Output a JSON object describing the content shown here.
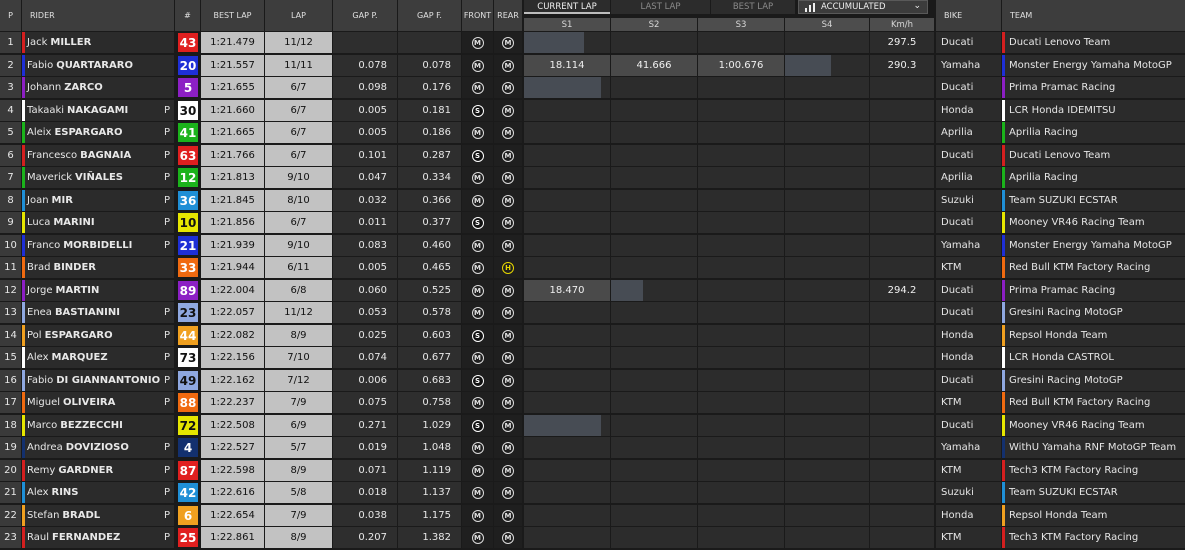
{
  "header": {
    "pos": "P",
    "rider": "RIDER",
    "number": "#",
    "best_lap": "BEST LAP",
    "lap": "LAP",
    "gap_prev": "GAP P.",
    "gap_first": "GAP F.",
    "front": "FRONT",
    "rear": "REAR",
    "bike": "BIKE",
    "team": "TEAM"
  },
  "sector_tabs": [
    {
      "label": "CURRENT LAP",
      "active": true
    },
    {
      "label": "LAST LAP",
      "active": false
    },
    {
      "label": "BEST LAP",
      "active": false
    }
  ],
  "view_dropdown": {
    "label": "ACCUMULATED",
    "icon": "bar-chart-icon",
    "caret": "chevron-down-icon"
  },
  "sector_headers": [
    "S1",
    "S2",
    "S3",
    "S4"
  ],
  "speed_header": "Km/h",
  "riders": [
    {
      "pos": "1",
      "first": "Jack",
      "last": "MILLER",
      "pit": "",
      "num": "43",
      "num_bg": "#e01f1f",
      "num_fg": "#ffffff",
      "best": "1:21.479",
      "lap": "11/12",
      "gp": "",
      "gf": "",
      "front": "M",
      "rear": "M",
      "sectors": [
        {
          "value": "",
          "fill": 0.7
        },
        {
          "value": "",
          "fill": 0
        },
        {
          "value": "",
          "fill": 0
        },
        {
          "value": "",
          "fill": 0
        }
      ],
      "speed": "297.5",
      "bike": "Ducati",
      "team": "Ducati Lenovo Team",
      "team_color": "#d41f1f"
    },
    {
      "pos": "2",
      "first": "Fabio",
      "last": "QUARTARARO",
      "pit": "",
      "num": "20",
      "num_bg": "#1e2fd6",
      "num_fg": "#ffffff",
      "best": "1:21.557",
      "lap": "11/11",
      "gp": "0.078",
      "gf": "0.078",
      "front": "M",
      "rear": "M",
      "sectors": [
        {
          "value": "18.114",
          "fill": 1
        },
        {
          "value": "41.666",
          "fill": 1
        },
        {
          "value": "1:00.676",
          "fill": 1
        },
        {
          "value": "",
          "fill": 0.55
        }
      ],
      "speed": "290.3",
      "bike": "Yamaha",
      "team": "Monster Energy Yamaha MotoGP",
      "team_color": "#1e2fd6"
    },
    {
      "pos": "3",
      "first": "Johann",
      "last": "ZARCO",
      "pit": "",
      "num": "5",
      "num_bg": "#8c1fc4",
      "num_fg": "#ffffff",
      "best": "1:21.655",
      "lap": "6/7",
      "gp": "0.098",
      "gf": "0.176",
      "front": "M",
      "rear": "M",
      "sectors": [
        {
          "value": "",
          "fill": 0.9
        },
        {
          "value": "",
          "fill": 0
        },
        {
          "value": "",
          "fill": 0
        },
        {
          "value": "",
          "fill": 0
        }
      ],
      "speed": "",
      "bike": "Ducati",
      "team": "Prima Pramac Racing",
      "team_color": "#8c1fc4"
    },
    {
      "pos": "4",
      "first": "Takaaki",
      "last": "NAKAGAMI",
      "pit": "P",
      "num": "30",
      "num_bg": "#ffffff",
      "num_fg": "#111111",
      "best": "1:21.660",
      "lap": "6/7",
      "gp": "0.005",
      "gf": "0.181",
      "front": "S",
      "rear": "M",
      "sectors": [
        {
          "value": "",
          "fill": 0
        },
        {
          "value": "",
          "fill": 0
        },
        {
          "value": "",
          "fill": 0
        },
        {
          "value": "",
          "fill": 0
        }
      ],
      "speed": "",
      "bike": "Honda",
      "team": "LCR Honda IDEMITSU",
      "team_color": "#ffffff"
    },
    {
      "pos": "5",
      "first": "Aleix",
      "last": "ESPARGARO",
      "pit": "P",
      "num": "41",
      "num_bg": "#1bb31b",
      "num_fg": "#ffffff",
      "best": "1:21.665",
      "lap": "6/7",
      "gp": "0.005",
      "gf": "0.186",
      "front": "M",
      "rear": "M",
      "sectors": [
        {
          "value": "",
          "fill": 0
        },
        {
          "value": "",
          "fill": 0
        },
        {
          "value": "",
          "fill": 0
        },
        {
          "value": "",
          "fill": 0
        }
      ],
      "speed": "",
      "bike": "Aprilia",
      "team": "Aprilia Racing",
      "team_color": "#1bb31b"
    },
    {
      "pos": "6",
      "first": "Francesco",
      "last": "BAGNAIA",
      "pit": "P",
      "num": "63",
      "num_bg": "#e01f1f",
      "num_fg": "#ffffff",
      "best": "1:21.766",
      "lap": "6/7",
      "gp": "0.101",
      "gf": "0.287",
      "front": "S",
      "rear": "M",
      "sectors": [
        {
          "value": "",
          "fill": 0
        },
        {
          "value": "",
          "fill": 0
        },
        {
          "value": "",
          "fill": 0
        },
        {
          "value": "",
          "fill": 0
        }
      ],
      "speed": "",
      "bike": "Ducati",
      "team": "Ducati Lenovo Team",
      "team_color": "#d41f1f"
    },
    {
      "pos": "7",
      "first": "Maverick",
      "last": "VIÑALES",
      "pit": "P",
      "num": "12",
      "num_bg": "#1bb31b",
      "num_fg": "#ffffff",
      "best": "1:21.813",
      "lap": "9/10",
      "gp": "0.047",
      "gf": "0.334",
      "front": "M",
      "rear": "M",
      "sectors": [
        {
          "value": "",
          "fill": 0
        },
        {
          "value": "",
          "fill": 0
        },
        {
          "value": "",
          "fill": 0
        },
        {
          "value": "",
          "fill": 0
        }
      ],
      "speed": "",
      "bike": "Aprilia",
      "team": "Aprilia Racing",
      "team_color": "#1bb31b"
    },
    {
      "pos": "8",
      "first": "Joan",
      "last": "MIR",
      "pit": "P",
      "num": "36",
      "num_bg": "#1f8fd6",
      "num_fg": "#ffffff",
      "best": "1:21.845",
      "lap": "8/10",
      "gp": "0.032",
      "gf": "0.366",
      "front": "M",
      "rear": "M",
      "sectors": [
        {
          "value": "",
          "fill": 0
        },
        {
          "value": "",
          "fill": 0
        },
        {
          "value": "",
          "fill": 0
        },
        {
          "value": "",
          "fill": 0
        }
      ],
      "speed": "",
      "bike": "Suzuki",
      "team": "Team SUZUKI ECSTAR",
      "team_color": "#1f8fd6"
    },
    {
      "pos": "9",
      "first": "Luca",
      "last": "MARINI",
      "pit": "P",
      "num": "10",
      "num_bg": "#e6e600",
      "num_fg": "#111111",
      "best": "1:21.856",
      "lap": "6/7",
      "gp": "0.011",
      "gf": "0.377",
      "front": "S",
      "rear": "M",
      "sectors": [
        {
          "value": "",
          "fill": 0
        },
        {
          "value": "",
          "fill": 0
        },
        {
          "value": "",
          "fill": 0
        },
        {
          "value": "",
          "fill": 0
        }
      ],
      "speed": "",
      "bike": "Ducati",
      "team": "Mooney VR46 Racing Team",
      "team_color": "#e6e600"
    },
    {
      "pos": "10",
      "first": "Franco",
      "last": "MORBIDELLI",
      "pit": "P",
      "num": "21",
      "num_bg": "#1e2fd6",
      "num_fg": "#ffffff",
      "best": "1:21.939",
      "lap": "9/10",
      "gp": "0.083",
      "gf": "0.460",
      "front": "M",
      "rear": "M",
      "sectors": [
        {
          "value": "",
          "fill": 0
        },
        {
          "value": "",
          "fill": 0
        },
        {
          "value": "",
          "fill": 0
        },
        {
          "value": "",
          "fill": 0
        }
      ],
      "speed": "",
      "bike": "Yamaha",
      "team": "Monster Energy Yamaha MotoGP",
      "team_color": "#1e2fd6"
    },
    {
      "pos": "11",
      "first": "Brad",
      "last": "BINDER",
      "pit": "",
      "num": "33",
      "num_bg": "#f06a10",
      "num_fg": "#ffffff",
      "best": "1:21.944",
      "lap": "6/11",
      "gp": "0.005",
      "gf": "0.465",
      "front": "M",
      "rear": "H",
      "sectors": [
        {
          "value": "",
          "fill": 0
        },
        {
          "value": "",
          "fill": 0
        },
        {
          "value": "",
          "fill": 0
        },
        {
          "value": "",
          "fill": 0
        }
      ],
      "speed": "",
      "bike": "KTM",
      "team": "Red Bull KTM Factory Racing",
      "team_color": "#f06a10"
    },
    {
      "pos": "12",
      "first": "Jorge",
      "last": "MARTIN",
      "pit": "",
      "num": "89",
      "num_bg": "#8c1fc4",
      "num_fg": "#ffffff",
      "best": "1:22.004",
      "lap": "6/8",
      "gp": "0.060",
      "gf": "0.525",
      "front": "M",
      "rear": "M",
      "sectors": [
        {
          "value": "18.470",
          "fill": 1
        },
        {
          "value": "",
          "fill": 0.37
        },
        {
          "value": "",
          "fill": 0
        },
        {
          "value": "",
          "fill": 0
        }
      ],
      "speed": "294.2",
      "bike": "Ducati",
      "team": "Prima Pramac Racing",
      "team_color": "#8c1fc4"
    },
    {
      "pos": "13",
      "first": "Enea",
      "last": "BASTIANINI",
      "pit": "P",
      "num": "23",
      "num_bg": "#8fa8e0",
      "num_fg": "#111111",
      "best": "1:22.057",
      "lap": "11/12",
      "gp": "0.053",
      "gf": "0.578",
      "front": "M",
      "rear": "M",
      "sectors": [
        {
          "value": "",
          "fill": 0
        },
        {
          "value": "",
          "fill": 0
        },
        {
          "value": "",
          "fill": 0
        },
        {
          "value": "",
          "fill": 0
        }
      ],
      "speed": "",
      "bike": "Ducati",
      "team": "Gresini Racing MotoGP",
      "team_color": "#8fa8e0"
    },
    {
      "pos": "14",
      "first": "Pol",
      "last": "ESPARGARO",
      "pit": "P",
      "num": "44",
      "num_bg": "#f0a020",
      "num_fg": "#ffffff",
      "best": "1:22.082",
      "lap": "8/9",
      "gp": "0.025",
      "gf": "0.603",
      "front": "S",
      "rear": "M",
      "sectors": [
        {
          "value": "",
          "fill": 0
        },
        {
          "value": "",
          "fill": 0
        },
        {
          "value": "",
          "fill": 0
        },
        {
          "value": "",
          "fill": 0
        }
      ],
      "speed": "",
      "bike": "Honda",
      "team": "Repsol Honda Team",
      "team_color": "#f0a020"
    },
    {
      "pos": "15",
      "first": "Alex",
      "last": "MARQUEZ",
      "pit": "P",
      "num": "73",
      "num_bg": "#ffffff",
      "num_fg": "#111111",
      "best": "1:22.156",
      "lap": "7/10",
      "gp": "0.074",
      "gf": "0.677",
      "front": "M",
      "rear": "M",
      "sectors": [
        {
          "value": "",
          "fill": 0
        },
        {
          "value": "",
          "fill": 0
        },
        {
          "value": "",
          "fill": 0
        },
        {
          "value": "",
          "fill": 0
        }
      ],
      "speed": "",
      "bike": "Honda",
      "team": "LCR Honda CASTROL",
      "team_color": "#ffffff"
    },
    {
      "pos": "16",
      "first": "Fabio",
      "last": "DI GIANNANTONIO",
      "pit": "P",
      "num": "49",
      "num_bg": "#8fa8e0",
      "num_fg": "#111111",
      "best": "1:22.162",
      "lap": "7/12",
      "gp": "0.006",
      "gf": "0.683",
      "front": "S",
      "rear": "M",
      "sectors": [
        {
          "value": "",
          "fill": 0
        },
        {
          "value": "",
          "fill": 0
        },
        {
          "value": "",
          "fill": 0
        },
        {
          "value": "",
          "fill": 0
        }
      ],
      "speed": "",
      "bike": "Ducati",
      "team": "Gresini Racing MotoGP",
      "team_color": "#8fa8e0"
    },
    {
      "pos": "17",
      "first": "Miguel",
      "last": "OLIVEIRA",
      "pit": "P",
      "num": "88",
      "num_bg": "#f06a10",
      "num_fg": "#ffffff",
      "best": "1:22.237",
      "lap": "7/9",
      "gp": "0.075",
      "gf": "0.758",
      "front": "M",
      "rear": "M",
      "sectors": [
        {
          "value": "",
          "fill": 0
        },
        {
          "value": "",
          "fill": 0
        },
        {
          "value": "",
          "fill": 0
        },
        {
          "value": "",
          "fill": 0
        }
      ],
      "speed": "",
      "bike": "KTM",
      "team": "Red Bull KTM Factory Racing",
      "team_color": "#f06a10"
    },
    {
      "pos": "18",
      "first": "Marco",
      "last": "BEZZECCHI",
      "pit": "",
      "num": "72",
      "num_bg": "#e6e600",
      "num_fg": "#111111",
      "best": "1:22.508",
      "lap": "6/9",
      "gp": "0.271",
      "gf": "1.029",
      "front": "S",
      "rear": "M",
      "sectors": [
        {
          "value": "",
          "fill": 0.9
        },
        {
          "value": "",
          "fill": 0
        },
        {
          "value": "",
          "fill": 0
        },
        {
          "value": "",
          "fill": 0
        }
      ],
      "speed": "",
      "bike": "Ducati",
      "team": "Mooney VR46 Racing Team",
      "team_color": "#e6e600"
    },
    {
      "pos": "19",
      "first": "Andrea",
      "last": "DOVIZIOSO",
      "pit": "P",
      "num": "4",
      "num_bg": "#13306e",
      "num_fg": "#ffffff",
      "best": "1:22.527",
      "lap": "5/7",
      "gp": "0.019",
      "gf": "1.048",
      "front": "M",
      "rear": "M",
      "sectors": [
        {
          "value": "",
          "fill": 0
        },
        {
          "value": "",
          "fill": 0
        },
        {
          "value": "",
          "fill": 0
        },
        {
          "value": "",
          "fill": 0
        }
      ],
      "speed": "",
      "bike": "Yamaha",
      "team": "WithU Yamaha RNF MotoGP Team",
      "team_color": "#13306e"
    },
    {
      "pos": "20",
      "first": "Remy",
      "last": "GARDNER",
      "pit": "P",
      "num": "87",
      "num_bg": "#e01f1f",
      "num_fg": "#ffffff",
      "best": "1:22.598",
      "lap": "8/9",
      "gp": "0.071",
      "gf": "1.119",
      "front": "M",
      "rear": "M",
      "sectors": [
        {
          "value": "",
          "fill": 0
        },
        {
          "value": "",
          "fill": 0
        },
        {
          "value": "",
          "fill": 0
        },
        {
          "value": "",
          "fill": 0
        }
      ],
      "speed": "",
      "bike": "KTM",
      "team": "Tech3 KTM Factory Racing",
      "team_color": "#d41f1f"
    },
    {
      "pos": "21",
      "first": "Alex",
      "last": "RINS",
      "pit": "P",
      "num": "42",
      "num_bg": "#1f8fd6",
      "num_fg": "#ffffff",
      "best": "1:22.616",
      "lap": "5/8",
      "gp": "0.018",
      "gf": "1.137",
      "front": "M",
      "rear": "M",
      "sectors": [
        {
          "value": "",
          "fill": 0
        },
        {
          "value": "",
          "fill": 0
        },
        {
          "value": "",
          "fill": 0
        },
        {
          "value": "",
          "fill": 0
        }
      ],
      "speed": "",
      "bike": "Suzuki",
      "team": "Team SUZUKI ECSTAR",
      "team_color": "#1f8fd6"
    },
    {
      "pos": "22",
      "first": "Stefan",
      "last": "BRADL",
      "pit": "P",
      "num": "6",
      "num_bg": "#f0a020",
      "num_fg": "#ffffff",
      "best": "1:22.654",
      "lap": "7/9",
      "gp": "0.038",
      "gf": "1.175",
      "front": "M",
      "rear": "M",
      "sectors": [
        {
          "value": "",
          "fill": 0
        },
        {
          "value": "",
          "fill": 0
        },
        {
          "value": "",
          "fill": 0
        },
        {
          "value": "",
          "fill": 0
        }
      ],
      "speed": "",
      "bike": "Honda",
      "team": "Repsol Honda Team",
      "team_color": "#f0a020"
    },
    {
      "pos": "23",
      "first": "Raul",
      "last": "FERNANDEZ",
      "pit": "P",
      "num": "25",
      "num_bg": "#e01f1f",
      "num_fg": "#ffffff",
      "best": "1:22.861",
      "lap": "8/9",
      "gp": "0.207",
      "gf": "1.382",
      "front": "M",
      "rear": "M",
      "sectors": [
        {
          "value": "",
          "fill": 0
        },
        {
          "value": "",
          "fill": 0
        },
        {
          "value": "",
          "fill": 0
        },
        {
          "value": "",
          "fill": 0
        }
      ],
      "speed": "",
      "bike": "KTM",
      "team": "Tech3 KTM Factory Racing",
      "team_color": "#d41f1f"
    }
  ]
}
